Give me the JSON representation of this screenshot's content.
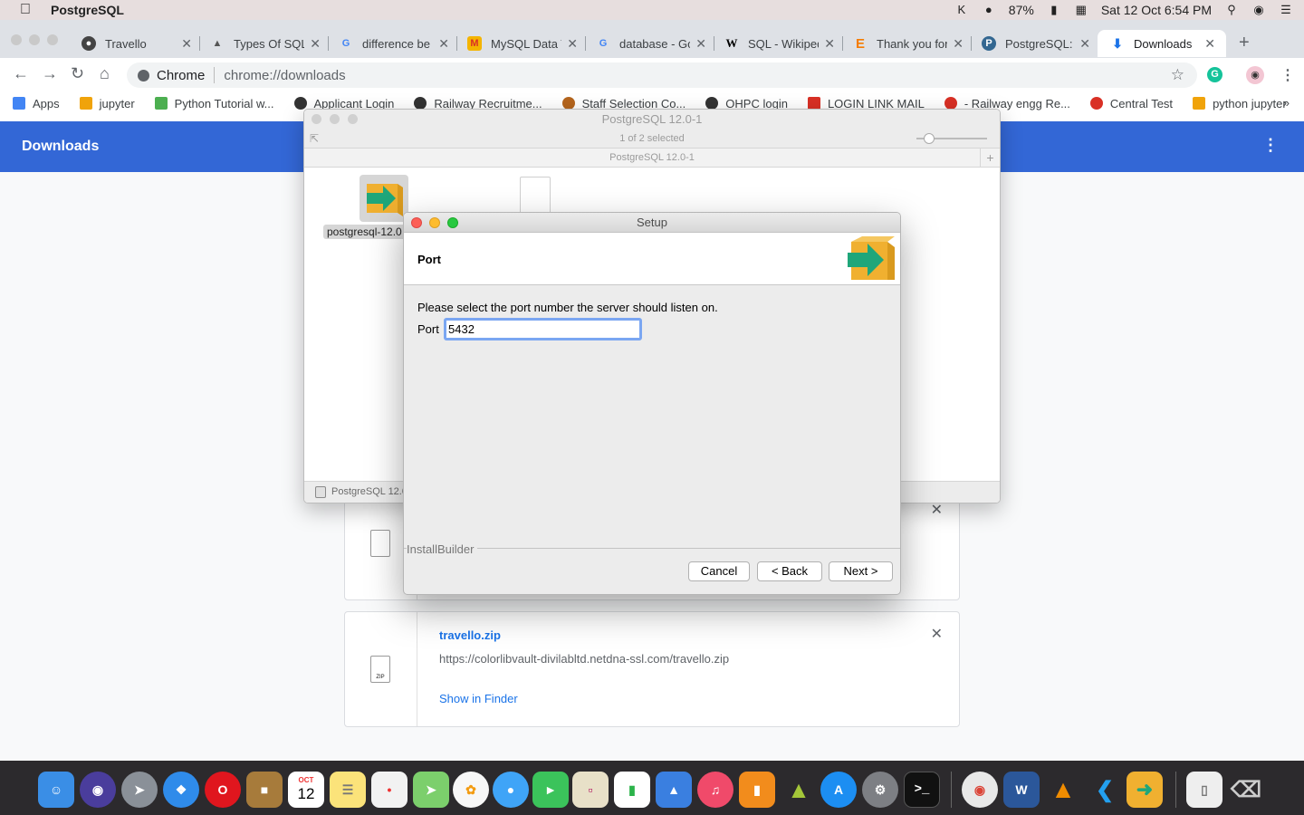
{
  "menubar": {
    "app_name": "PostgreSQL",
    "battery": "87%",
    "datetime": "Sat 12 Oct  6:54 PM"
  },
  "tabs": [
    {
      "title": "Travello"
    },
    {
      "title": "Types Of SQL"
    },
    {
      "title": "difference be"
    },
    {
      "title": "MySQL Data T"
    },
    {
      "title": "database - Go"
    },
    {
      "title": "SQL - Wikiped"
    },
    {
      "title": "Thank you for"
    },
    {
      "title": "PostgreSQL: I"
    },
    {
      "title": "Downloads"
    }
  ],
  "omnibox": {
    "chip": "Chrome",
    "url": "chrome://downloads"
  },
  "bookmarks": [
    {
      "label": "Apps",
      "color": "#4285f4"
    },
    {
      "label": "jupyter",
      "color": "#f0a30a"
    },
    {
      "label": "Python Tutorial w...",
      "color": "#4caf50"
    },
    {
      "label": "Applicant Login",
      "color": "#333333"
    },
    {
      "label": "Railway Recruitme...",
      "color": "#333333"
    },
    {
      "label": "Staff Selection Co...",
      "color": "#b5651d"
    },
    {
      "label": "OHPC login",
      "color": "#333333"
    },
    {
      "label": "LOGIN LINK MAIL",
      "color": "#d93025"
    },
    {
      "label": "- Railway engg Re...",
      "color": "#d93025"
    },
    {
      "label": "Central Test",
      "color": "#d93025"
    },
    {
      "label": "python jupyter",
      "color": "#f0a30a"
    }
  ],
  "downloads_page": {
    "title": "Downloads",
    "items": [
      {
        "name": "travello.zip",
        "url": "https://colorlibvault-divilabltd.netdna-ssl.com/travello.zip",
        "action": "Show in Finder",
        "file_type": "ZIP"
      }
    ]
  },
  "finder_window": {
    "title": "PostgreSQL 12.0-1",
    "selection": "1 of 2 selected",
    "path": "PostgreSQL 12.0-1",
    "icon_label": "postgresql-12.0",
    "status": "PostgreSQL 12.0-1"
  },
  "setup_dialog": {
    "title": "Setup",
    "heading": "Port",
    "prompt": "Please select the port number the server should listen on.",
    "port_label": "Port",
    "port_value": "5432",
    "footer_brand": "InstallBuilder",
    "cancel_label": "Cancel",
    "back_label": "< Back",
    "next_label": "Next >"
  },
  "dock": {
    "calendar_month": "OCT",
    "calendar_day": "12"
  }
}
